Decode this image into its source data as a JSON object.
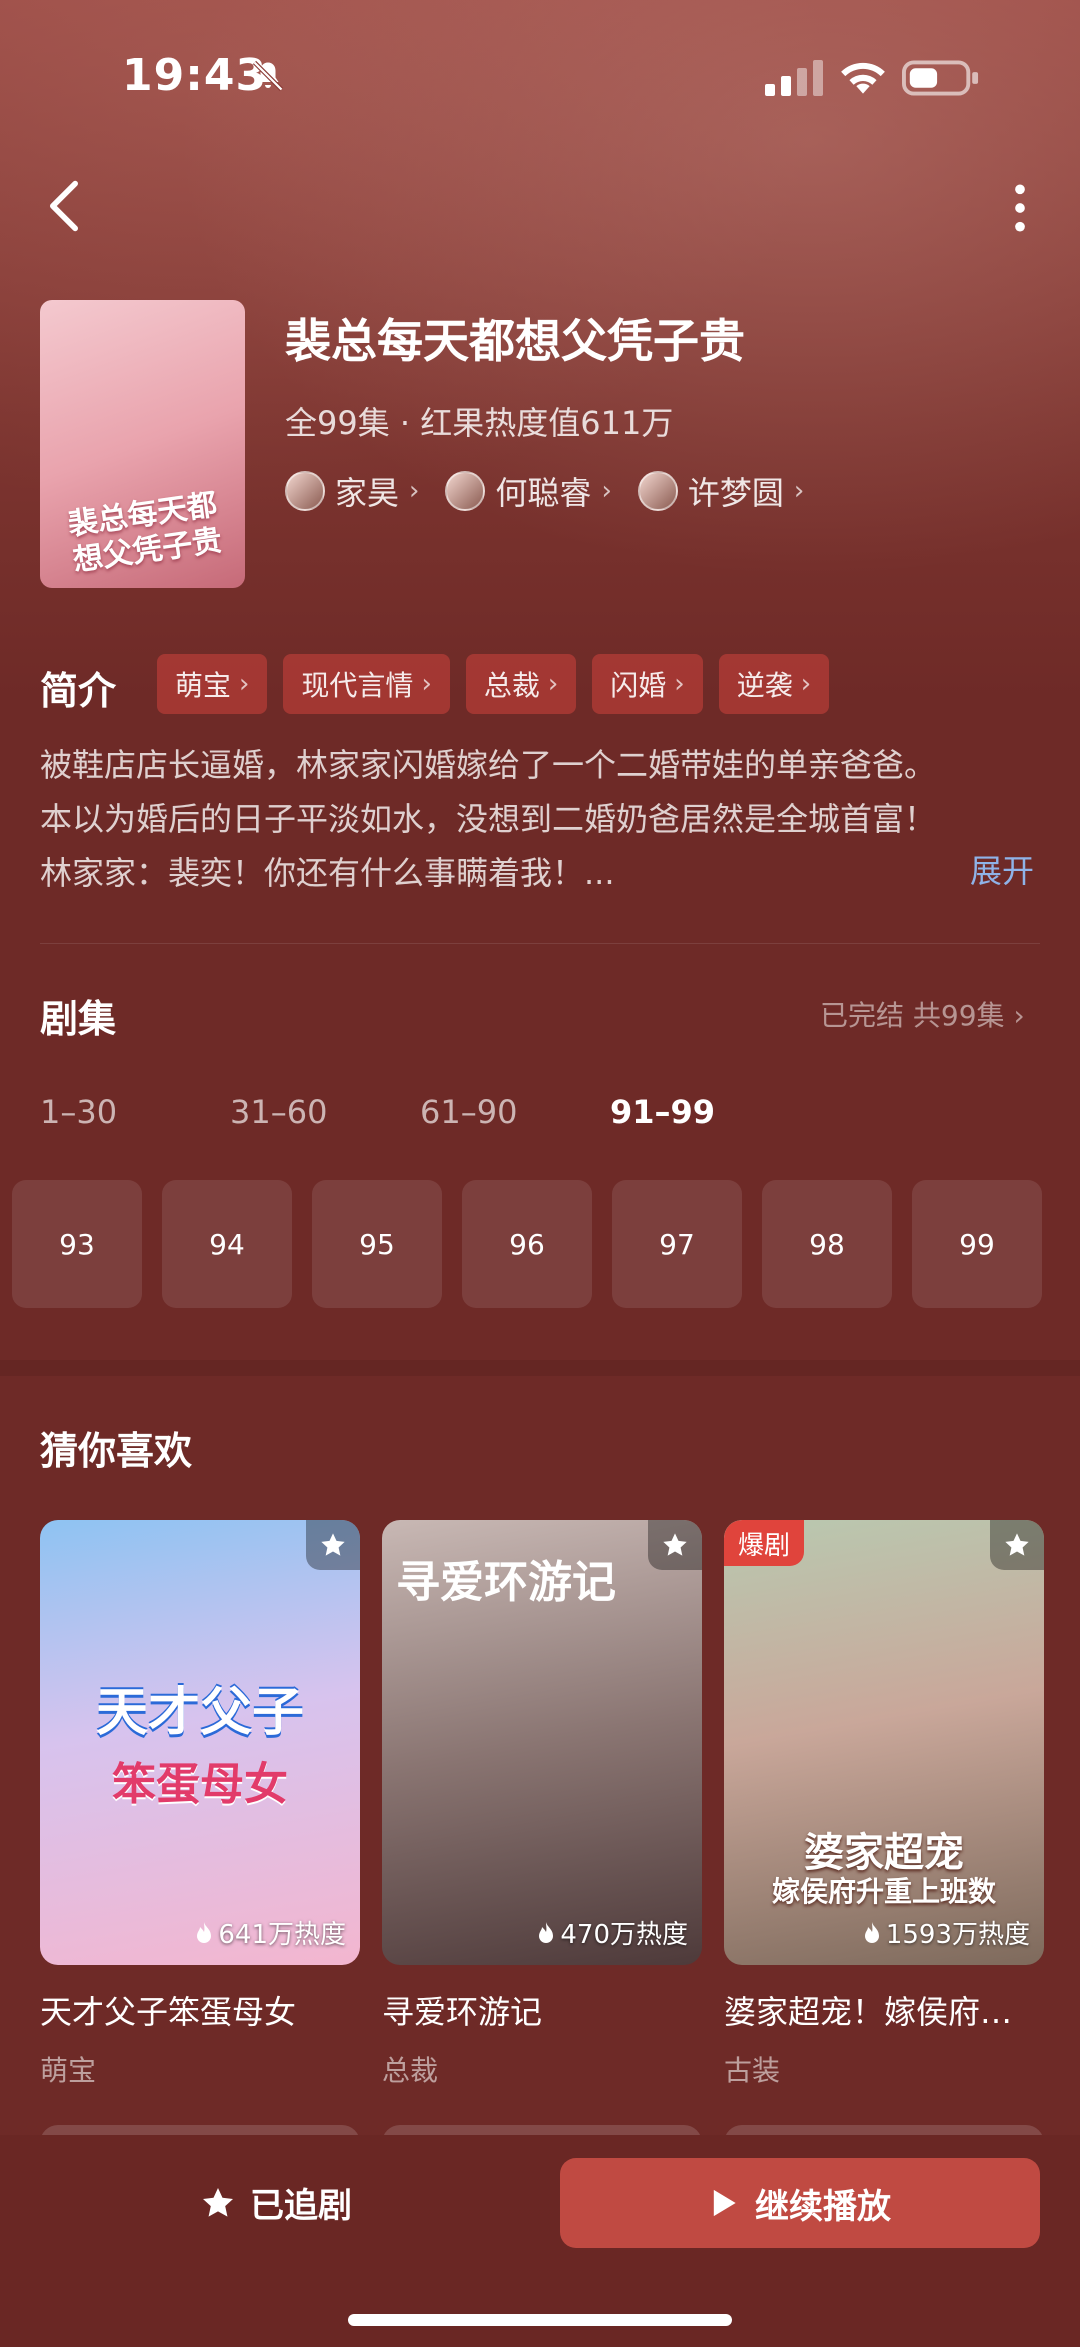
{
  "status_bar": {
    "time": "19:43"
  },
  "drama": {
    "title": "裴总每天都想父凭子贵",
    "meta": "全99集 · 红果热度值611万",
    "poster_text": "裴总每天都想父凭子贵",
    "actors": [
      {
        "name": "家昊"
      },
      {
        "name": "何聪睿"
      },
      {
        "name": "许梦圆"
      }
    ]
  },
  "intro": {
    "label": "简介",
    "tags": [
      "萌宝",
      "现代言情",
      "总裁",
      "闪婚",
      "逆袭"
    ],
    "lines": [
      "被鞋店店长逼婚，林家家闪婚嫁给了一个二婚带娃的单亲爸爸。",
      "本以为婚后的日子平淡如水，没想到二婚奶爸居然是全城首富！",
      "林家家：裴奕！你还有什么事瞒着我！..."
    ],
    "expand": "展开"
  },
  "episodes": {
    "label": "剧集",
    "status": "已完结 共99集",
    "ranges": [
      "1–30",
      "31–60",
      "61–90",
      "91–99"
    ],
    "active_range": "91–99",
    "items": [
      "93",
      "94",
      "95",
      "96",
      "97",
      "98",
      "99"
    ]
  },
  "recommend": {
    "label": "猜你喜欢",
    "cards": [
      {
        "title": "天才父子笨蛋母女",
        "genre": "萌宝",
        "heat": "641万热度",
        "poster_text": "天才父子",
        "poster_text2": "笨蛋母女",
        "badge": ""
      },
      {
        "title": "寻爱环游记",
        "genre": "总裁",
        "heat": "470万热度",
        "poster_text": "寻爱环游记",
        "poster_text2": "",
        "badge": ""
      },
      {
        "title": "婆家超宠！嫁侯府…",
        "genre": "古装",
        "heat": "1593万热度",
        "poster_text": "婆家超宠",
        "poster_text2": "嫁侯府升重上班数",
        "badge": "爆剧"
      }
    ]
  },
  "bottom": {
    "follow_label": "已追剧",
    "play_label": "继续播放"
  },
  "colors": {
    "accent": "#c04a42",
    "background": "#6e2a27",
    "link": "#8fb3e8"
  },
  "icons": [
    "back-icon",
    "more-icon",
    "star-icon",
    "play-icon",
    "flame-icon",
    "bell-mute-icon",
    "wifi-icon",
    "battery-icon",
    "signal-icon"
  ]
}
